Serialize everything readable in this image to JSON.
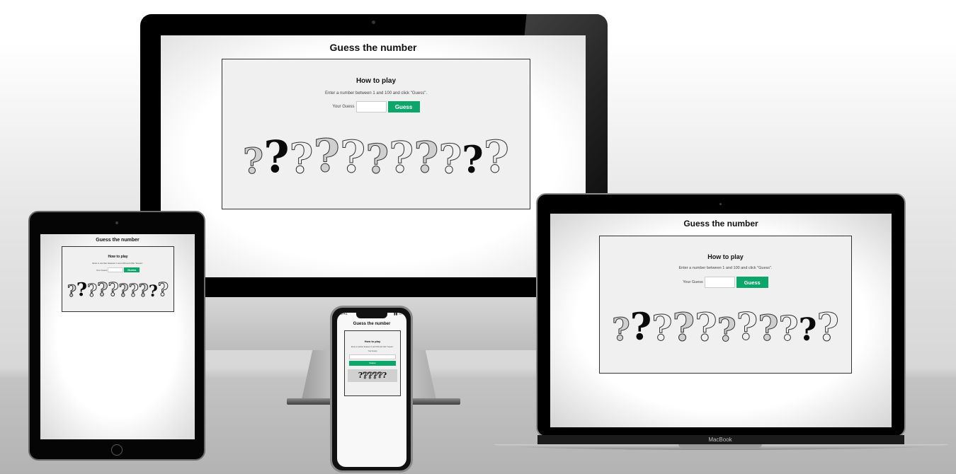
{
  "app": {
    "title": "Guess the number",
    "how_to_play": "How to play",
    "instructions": "Enter a number between 1 and 100 and click \"Guess\".",
    "guess_label": "Your Guess",
    "guess_value": "",
    "guess_button": "Guess"
  },
  "devices": {
    "laptop_brand": "MacBook",
    "phone_time": "9:41"
  },
  "decor": {
    "qmark_glyph": "?",
    "icon": "question-mark-illustration",
    "accent_color": "#0ca66b"
  }
}
